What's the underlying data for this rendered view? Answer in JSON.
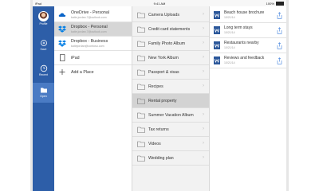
{
  "status_bar": {
    "carrier": "iPad",
    "time": "9:41 AM",
    "battery": "100%"
  },
  "rail": {
    "items": [
      {
        "label": "Profile",
        "icon": "avatar"
      },
      {
        "label": "Save",
        "icon": "save-icon"
      },
      {
        "label": "Recent",
        "icon": "clock-icon"
      },
      {
        "label": "Open",
        "icon": "folder-icon"
      }
    ],
    "active_index": 3
  },
  "accounts": [
    {
      "title": "OneDrive - Personal",
      "subtitle": "katie.jordan.7@outlook.com",
      "icon": "onedrive-icon"
    },
    {
      "title": "Dropbox - Personal",
      "subtitle": "katie.jordan.7@outlook.com",
      "icon": "dropbox-icon"
    },
    {
      "title": "Dropbox - Business",
      "subtitle": "katiejordan@contoso.com",
      "icon": "dropbox-icon"
    },
    {
      "title": "iPad",
      "subtitle": "",
      "icon": "ipad-icon"
    },
    {
      "title": "Add a Place",
      "subtitle": "",
      "icon": "plus-icon"
    }
  ],
  "selected_account": 1,
  "folders": [
    "Camera Uploads",
    "Credit card statements",
    "Family Photo Album",
    "New York Album",
    "Passport & visas",
    "Recipes",
    "Rental property",
    "Summer Vacation Album",
    "Tax returns",
    "Videos",
    "Wedding plan"
  ],
  "selected_folder": 6,
  "files": [
    {
      "name": "Beach house brochure",
      "date": "10/21/14",
      "icon": "word-icon"
    },
    {
      "name": "Long term stays",
      "date": "10/21/14",
      "icon": "word-icon"
    },
    {
      "name": "Restaurants nearby",
      "date": "10/21/14",
      "icon": "word-icon"
    },
    {
      "name": "Reviews and feedback",
      "date": "10/21/14",
      "icon": "word-icon"
    }
  ],
  "colors": {
    "rail": "#2d5ea8",
    "word_blue": "#2b579a",
    "dropbox_blue": "#007ee5",
    "onedrive_blue": "#0a64c8"
  }
}
